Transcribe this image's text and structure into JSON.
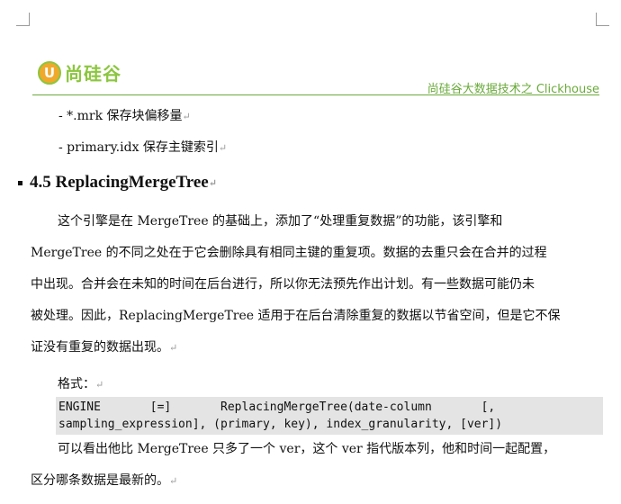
{
  "header": {
    "logo_mark": "U",
    "logo_text": "尚硅谷",
    "right_title": "尚硅谷大数据技术之 Clickhouse"
  },
  "bullets": [
    "- *.mrk 保存块偏移量",
    "- primary.idx 保存主键索引"
  ],
  "section": {
    "title": "4.5 ReplacingMergeTree"
  },
  "paragraph1": [
    "这个引擎是在 MergeTree 的基础上，添加了“处理重复数据”的功能，该引擎和",
    "MergeTree 的不同之处在于它会删除具有相同主键的重复项。数据的去重只会在合并的过程",
    "中出现。合并会在未知的时间在后台进行，所以你无法预先作出计划。有一些数据可能仍未",
    "被处理。因此，ReplacingMergeTree 适用于在后台清除重复的数据以节省空间，但是它不保",
    "证没有重复的数据出现。"
  ],
  "format_label": "格式：",
  "code": [
    "ENGINE       [=]       ReplacingMergeTree(date-column       [,",
    "sampling_expression], (primary, key), index_granularity, [ver])"
  ],
  "paragraph2": [
    "可以看出他比 MergeTree 只多了一个 ver，这个 ver 指代版本列，他和时间一起配置，",
    "区分哪条数据是最新的。"
  ],
  "colors": {
    "accent_green": "#6aaa3a",
    "logo_orange": "#f1a92b",
    "code_bg": "#e4e4e4"
  }
}
